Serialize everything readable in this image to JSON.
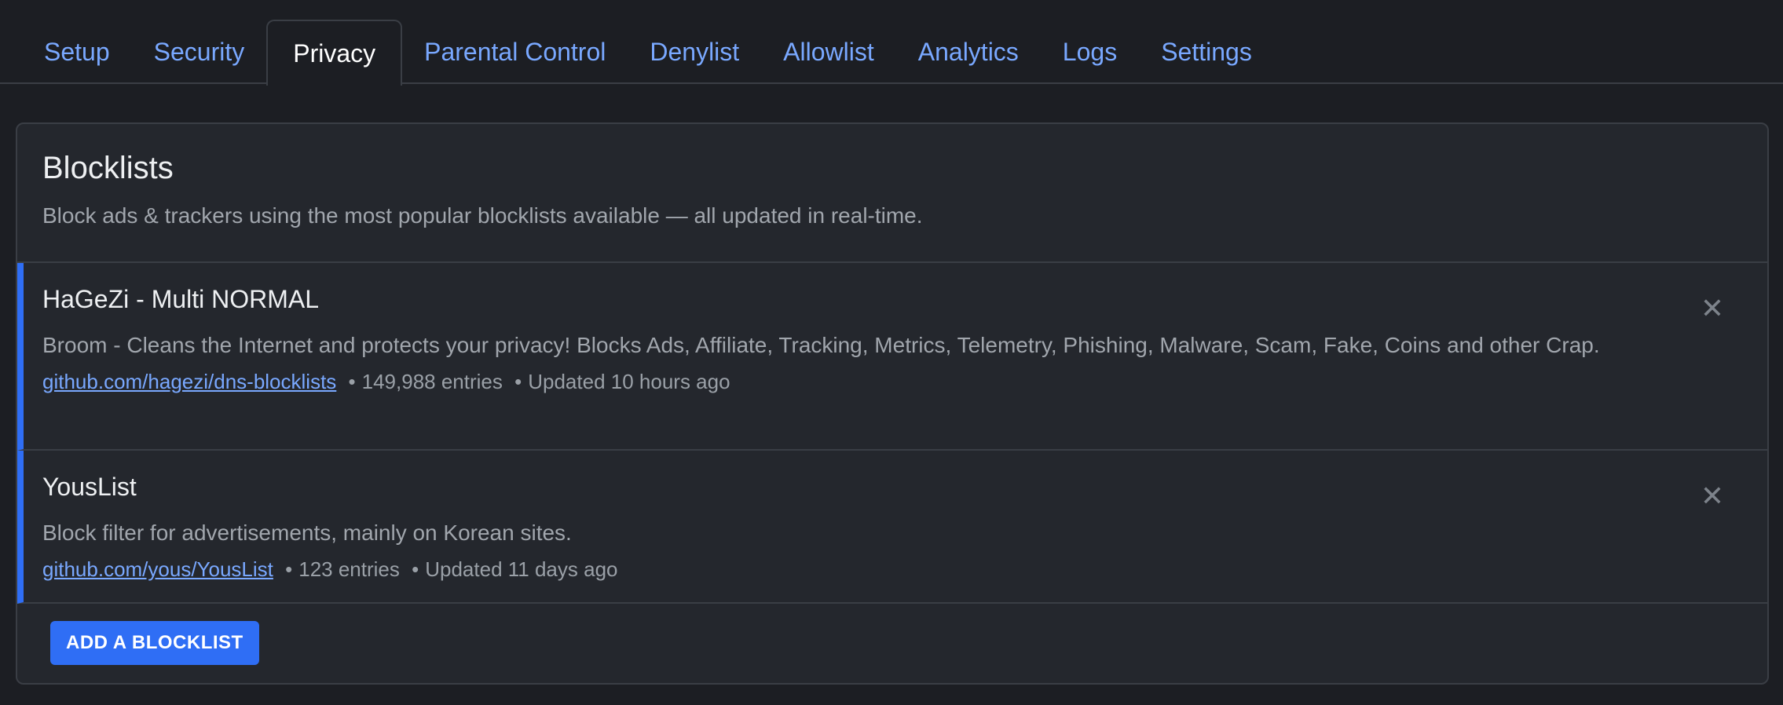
{
  "tabs": [
    {
      "label": "Setup"
    },
    {
      "label": "Security"
    },
    {
      "label": "Privacy"
    },
    {
      "label": "Parental Control"
    },
    {
      "label": "Denylist"
    },
    {
      "label": "Allowlist"
    },
    {
      "label": "Analytics"
    },
    {
      "label": "Logs"
    },
    {
      "label": "Settings"
    }
  ],
  "active_tab": "Privacy",
  "card": {
    "title": "Blocklists",
    "description": "Block ads & trackers using the most popular blocklists available — all updated in real-time."
  },
  "blocklists": [
    {
      "name": "HaGeZi - Multi NORMAL",
      "description": "Broom - Cleans the Internet and protects your privacy! Blocks Ads, Affiliate, Tracking, Metrics, Telemetry, Phishing, Malware, Scam, Fake, Coins and other Crap.",
      "link": "github.com/hagezi/dns-blocklists",
      "separator": "•",
      "entries": "149,988 entries",
      "updated": "Updated 10 hours ago",
      "remove_glyph": "✕"
    },
    {
      "name": "YousList",
      "description": "Block filter for advertisements, mainly on Korean sites.",
      "link": "github.com/yous/YousList",
      "separator": "•",
      "entries": "123 entries",
      "updated": "Updated 11 days ago",
      "remove_glyph": "✕"
    }
  ],
  "footer": {
    "add_label": "ADD A BLOCKLIST"
  },
  "colors": {
    "background": "#1c1e23",
    "card": "#24272d",
    "border": "#3a3e45",
    "accent": "#2f6ef5",
    "link": "#79a8ff"
  },
  "icons": {
    "remove": "close-icon"
  }
}
